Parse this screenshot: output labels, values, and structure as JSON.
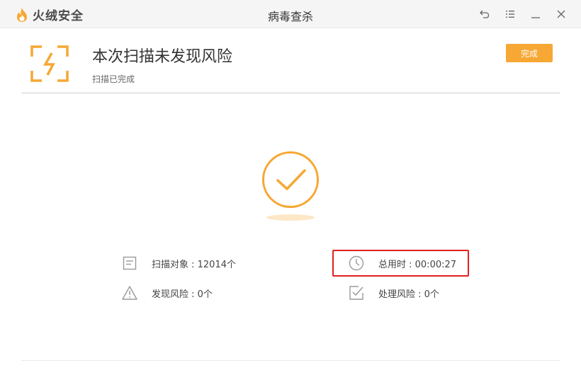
{
  "app": {
    "logo_text": "火绒安全",
    "window_title": "病毒查杀"
  },
  "header": {
    "headline": "本次扫描未发现风险",
    "subline": "扫描已完成",
    "done_label": "完成"
  },
  "stats": {
    "scan_objects": "扫描对象 : 12014个",
    "total_time": "总用时 : 00:00:27",
    "risks_found": "发现风险 : 0个",
    "risks_handled": "处理风险 : 0个"
  },
  "colors": {
    "accent": "#f7a733",
    "highlight": "#e02020",
    "icon_gray": "#9a9a9a"
  }
}
